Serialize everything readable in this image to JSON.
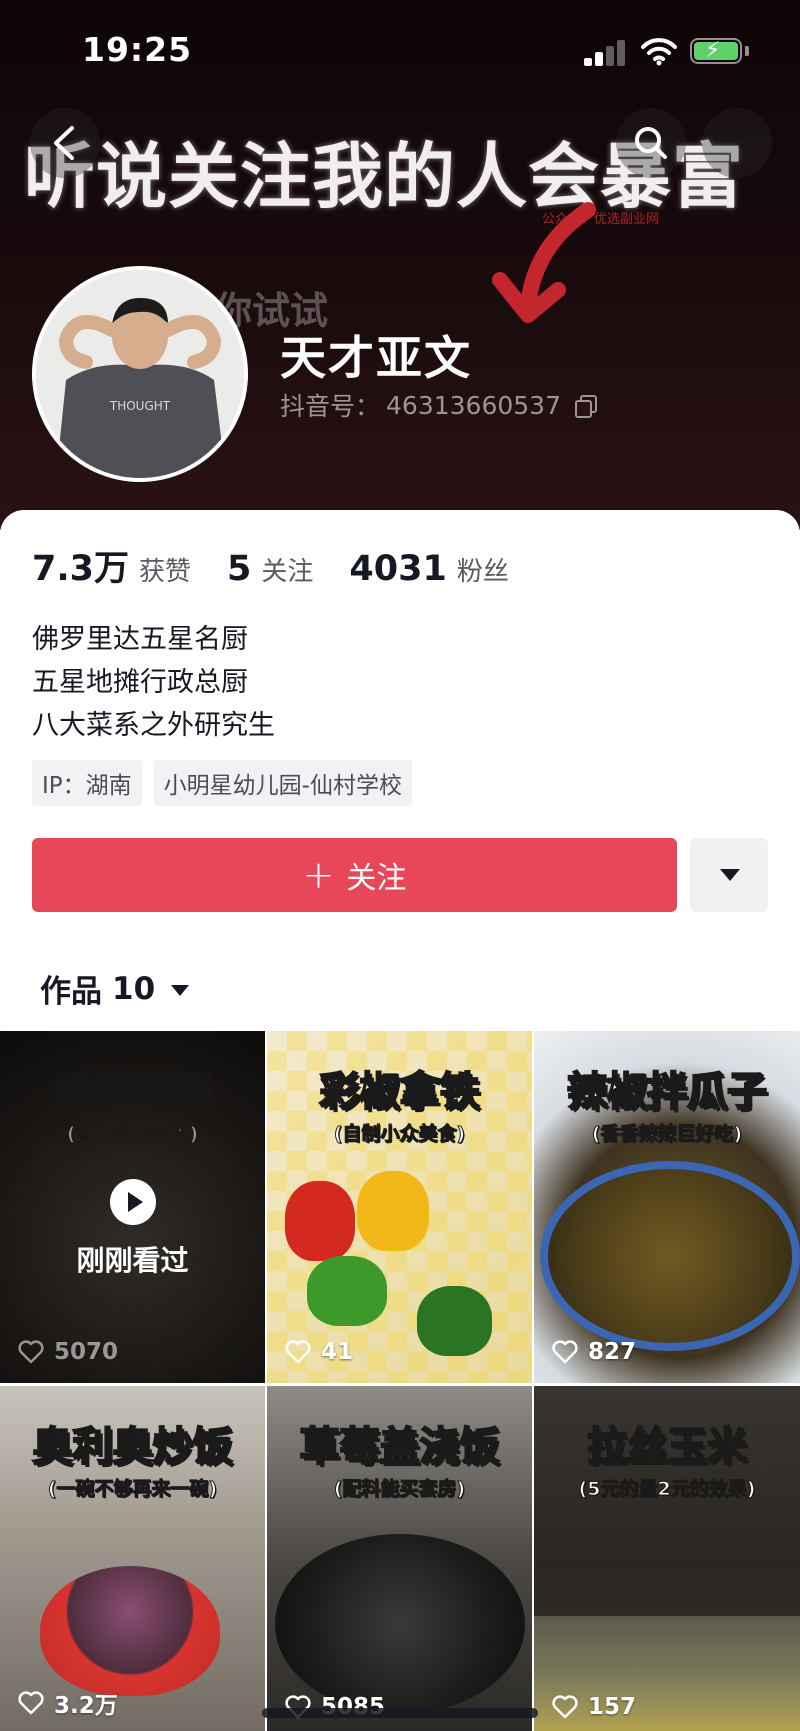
{
  "status_bar": {
    "time": "19:25"
  },
  "banner": {
    "headline": "听说关注我的人会暴富",
    "subtitle": "你试试",
    "watermark": "公众号：优选副业网"
  },
  "profile": {
    "name": "天才亚文",
    "id_label": "抖音号：",
    "id_value": "46313660537"
  },
  "stats": [
    {
      "value": "7.3万",
      "label": "获赞"
    },
    {
      "value": "5",
      "label": "关注"
    },
    {
      "value": "4031",
      "label": "粉丝"
    }
  ],
  "bio": [
    "佛罗里达五星名厨",
    "五星地摊行政总厨",
    "八大菜系之外研究生"
  ],
  "tags": [
    "IP：湖南",
    "小明星幼儿园-仙村学校"
  ],
  "actions": {
    "follow_label": "关注",
    "follow_color": "#e8475a"
  },
  "works_tab": {
    "label": "作品",
    "count": "10"
  },
  "videos": [
    {
      "title": "爆烤钢筋",
      "subtitle": "(惊呆国外友人)",
      "likes": "5070",
      "overlay": "刚刚看过"
    },
    {
      "title": "彩椒拿铁",
      "subtitle": "(自制小众美食)",
      "likes": "41"
    },
    {
      "title": "辣椒拌瓜子",
      "subtitle": "(香香辣辣巨好吃)",
      "likes": "827"
    },
    {
      "title": "奥利奥炒饭",
      "subtitle": "(一碗不够再来一碗)",
      "likes": "3.2万"
    },
    {
      "title": "草莓盖浇饭",
      "subtitle": "(配料能买套房)",
      "likes": "5085"
    },
    {
      "title": "拉丝玉米",
      "subtitle": "(5元的量2元的效果)",
      "likes": "157"
    }
  ]
}
